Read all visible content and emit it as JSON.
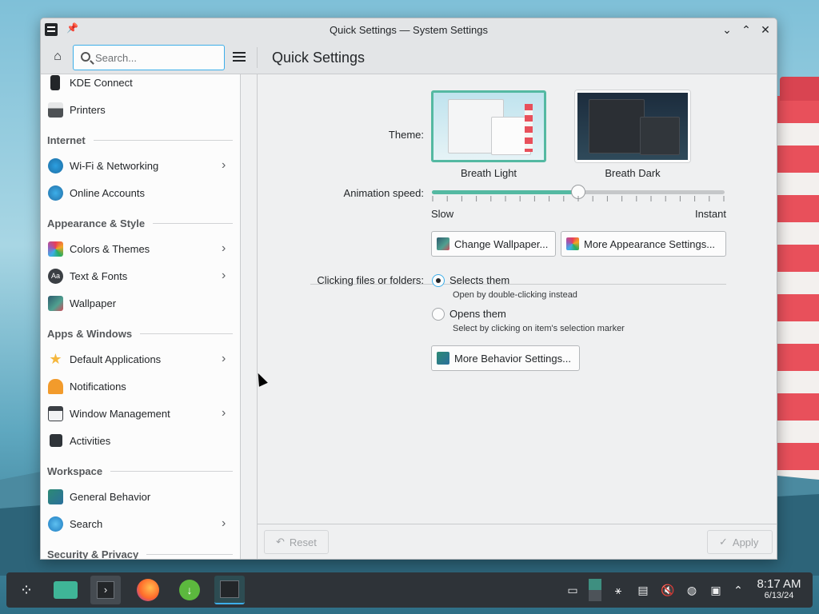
{
  "window": {
    "title": "Quick Settings — System Settings"
  },
  "toolbar": {
    "search_placeholder": "Search...",
    "page_title": "Quick Settings"
  },
  "sidebar": {
    "items": [
      {
        "label": "KDE Connect",
        "icon": "phone-icon",
        "chevron": false
      },
      {
        "label": "Printers",
        "icon": "printer-icon",
        "chevron": false
      },
      {
        "section": "Internet"
      },
      {
        "label": "Wi-Fi & Networking",
        "icon": "globe-icon",
        "chevron": true
      },
      {
        "label": "Online Accounts",
        "icon": "online-accounts-icon",
        "chevron": false
      },
      {
        "section": "Appearance & Style"
      },
      {
        "label": "Colors & Themes",
        "icon": "palette-icon",
        "chevron": true
      },
      {
        "label": "Text & Fonts",
        "icon": "font-icon",
        "chevron": true
      },
      {
        "label": "Wallpaper",
        "icon": "wallpaper-icon",
        "chevron": false
      },
      {
        "section": "Apps & Windows"
      },
      {
        "label": "Default Applications",
        "icon": "star-icon",
        "chevron": true
      },
      {
        "label": "Notifications",
        "icon": "bell-icon",
        "chevron": false
      },
      {
        "label": "Window Management",
        "icon": "window-icon",
        "chevron": true
      },
      {
        "label": "Activities",
        "icon": "activities-icon",
        "chevron": false
      },
      {
        "section": "Workspace"
      },
      {
        "label": "General Behavior",
        "icon": "behavior-icon",
        "chevron": false
      },
      {
        "label": "Search",
        "icon": "search-icon",
        "chevron": true
      },
      {
        "section": "Security & Privacy"
      }
    ]
  },
  "content": {
    "theme_label": "Theme:",
    "themes": [
      {
        "name": "Breath Light",
        "selected": true
      },
      {
        "name": "Breath Dark",
        "selected": false
      }
    ],
    "animation_label": "Animation speed:",
    "animation_min": "Slow",
    "animation_max": "Instant",
    "animation_value": 0.5,
    "change_wallpaper": "Change Wallpaper...",
    "more_appearance": "More Appearance Settings...",
    "clicking_label": "Clicking files or folders:",
    "option1": {
      "label": "Selects them",
      "hint": "Open by double-clicking instead",
      "checked": true
    },
    "option2": {
      "label": "Opens them",
      "hint": "Select by clicking on item's selection marker",
      "checked": false
    },
    "more_behavior": "More Behavior Settings...",
    "reset": "Reset",
    "apply": "Apply"
  },
  "taskbar": {
    "apps": [
      "application-launcher-icon",
      "file-manager-icon",
      "terminal-icon",
      "firefox-icon",
      "downloader-icon",
      "system-settings-icon"
    ],
    "time": "8:17 AM",
    "date": "6/13/24"
  },
  "colors": {
    "accent": "#3daee9",
    "highlight": "#54b9a2",
    "taskbar": "#2e3338"
  }
}
